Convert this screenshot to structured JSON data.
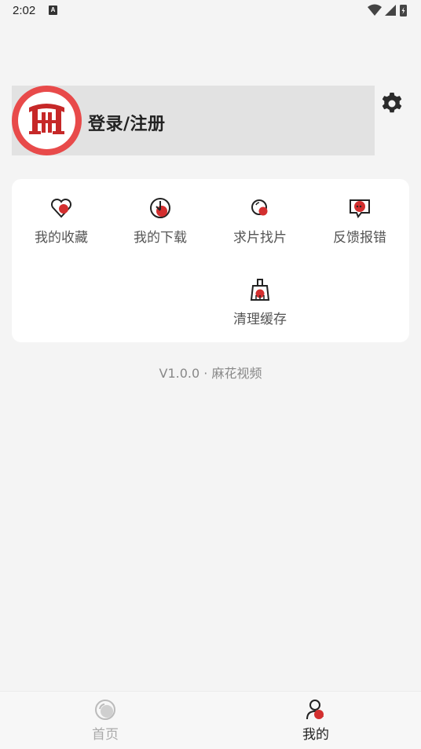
{
  "status_bar": {
    "time": "2:02",
    "notification_letter": "A"
  },
  "profile": {
    "login_label": "登录/注册"
  },
  "menu": {
    "items": [
      {
        "label": "我的收藏",
        "icon": "heart-icon"
      },
      {
        "label": "我的下载",
        "icon": "download-icon"
      },
      {
        "label": "求片找片",
        "icon": "search-icon"
      },
      {
        "label": "反馈报错",
        "icon": "feedback-icon"
      },
      {
        "label": "清理缓存",
        "icon": "broom-icon"
      }
    ]
  },
  "footer": {
    "version": "V1.0.0 · 麻花视频"
  },
  "tabbar": {
    "tabs": [
      {
        "label": "首页",
        "active": false
      },
      {
        "label": "我的",
        "active": true
      }
    ]
  },
  "colors": {
    "accent": "#e84a4a",
    "icon_red": "#d32f2f",
    "active_tab_text": "#222222",
    "inactive_tab_text": "#aaaaaa"
  }
}
